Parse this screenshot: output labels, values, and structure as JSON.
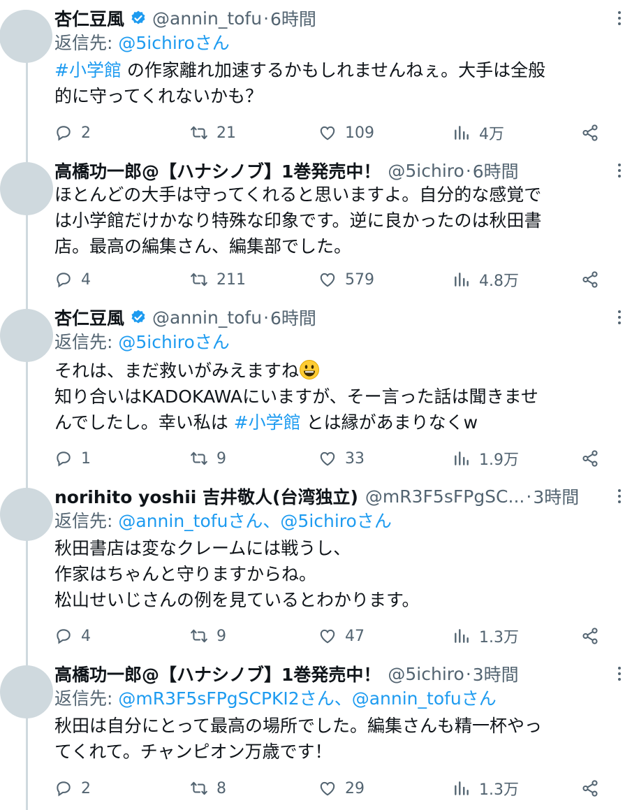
{
  "tweets": [
    {
      "name": "杏仁豆風",
      "verified": true,
      "handle": "@annin_tofu",
      "time": "6時間",
      "reply_prefix": "返信先: ",
      "reply_to": "@5ichiroさん",
      "body_lines": [
        {
          "hashtag": "#小学館",
          "text": " の作家離れ加速するかもしれませんねぇ。大手は全般"
        },
        {
          "text": "的に守ってくれないかも？"
        }
      ],
      "replies": "2",
      "retweets": "21",
      "likes": "109",
      "views": "4万"
    },
    {
      "name": "高橋功一郎@【ハナシノブ】1巻発売中！",
      "verified": false,
      "handle": "@5ichiro",
      "time": "6時間",
      "body_lines": [
        {
          "text": "ほとんどの大手は守ってくれると思いますよ。自分的な感覚で"
        },
        {
          "text": "は小学館だけかなり特殊な印象です。逆に良かったのは秋田書"
        },
        {
          "text": "店。最高の編集さん、編集部でした。"
        }
      ],
      "replies": "4",
      "retweets": "211",
      "likes": "579",
      "views": "4.8万"
    },
    {
      "name": "杏仁豆風",
      "verified": true,
      "handle": "@annin_tofu",
      "time": "6時間",
      "reply_prefix": "返信先: ",
      "reply_to": "@5ichiroさん",
      "body_lines": [
        {
          "text": "それは、まだ救いがみえますね",
          "emoji": "grinning-face"
        },
        {
          "text": "知り合いはKADOKAWAにいますが、そー言った話は聞きませ"
        },
        {
          "text": "んでしたし。幸い私は ",
          "hashtag": "#小学館",
          "after": " とは縁があまりなくw"
        }
      ],
      "replies": "1",
      "retweets": "9",
      "likes": "33",
      "views": "1.9万"
    },
    {
      "name": "norihito yoshii 吉井敬人(台湾独立)",
      "verified": false,
      "handle": "@mR3F5sFPgSC...",
      "time": "3時間",
      "reply_prefix": "返信先: ",
      "reply_to": "@annin_tofuさん、@5ichiroさん",
      "body_lines": [
        {
          "text": "秋田書店は変なクレームには戦うし、"
        },
        {
          "text": "作家はちゃんと守りますからね。"
        },
        {
          "text": "松山せいじさんの例を見ているとわかります。"
        }
      ],
      "replies": "4",
      "retweets": "9",
      "likes": "47",
      "views": "1.3万"
    },
    {
      "name": "高橋功一郎@【ハナシノブ】1巻発売中！",
      "verified": false,
      "handle": "@5ichiro",
      "time": "3時間",
      "reply_prefix": "返信先: ",
      "reply_to": "@mR3F5sFPgSCPKI2さん、@annin_tofuさん",
      "body_lines": [
        {
          "text": "秋田は自分にとって最高の場所でした。編集さんも精一杯やっ"
        },
        {
          "text": "てくれて。チャンピオン万歳です！"
        }
      ],
      "replies": "2",
      "retweets": "8",
      "likes": "29",
      "views": "1.3万"
    }
  ],
  "colors": {
    "link": "#1d9bf0",
    "muted": "#536471",
    "verified": "#1d9bf0",
    "avatar": "#cfd9de"
  }
}
